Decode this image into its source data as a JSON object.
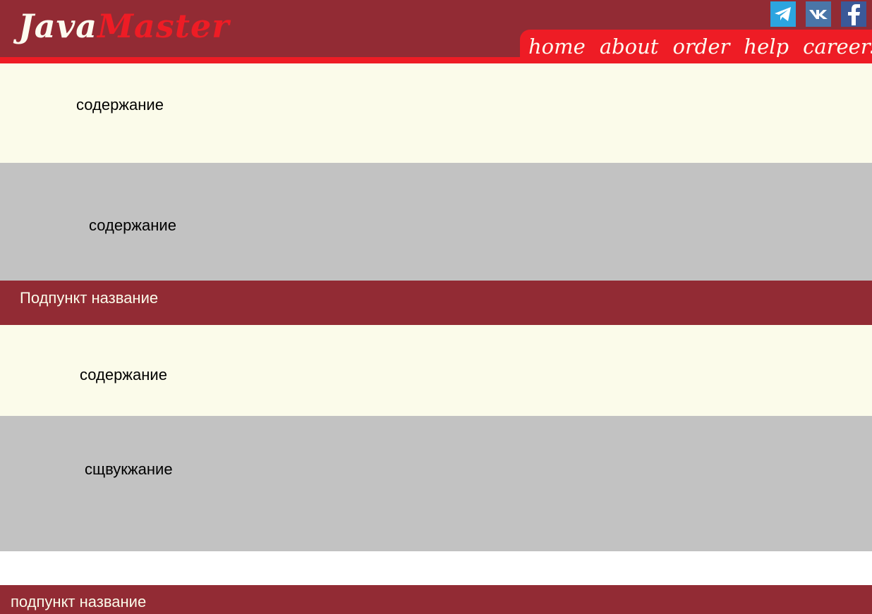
{
  "header": {
    "logo_part1": "Java",
    "logo_part2": "Master",
    "nav": [
      "home",
      "about",
      "order",
      "help",
      "careers"
    ],
    "social": [
      "telegram-icon",
      "vk-icon",
      "facebook-icon"
    ]
  },
  "sections": [
    {
      "text": "содержание"
    },
    {
      "text": "содержание"
    },
    {
      "text": "Подпункт  название"
    },
    {
      "text": "содержание"
    },
    {
      "text": "сщвукжание"
    },
    {
      "text": "подпункт название"
    }
  ],
  "colors": {
    "header": "#922b34",
    "accent": "#ee1c25",
    "cream": "#fbfbea",
    "grey": "#c2c2c2"
  }
}
